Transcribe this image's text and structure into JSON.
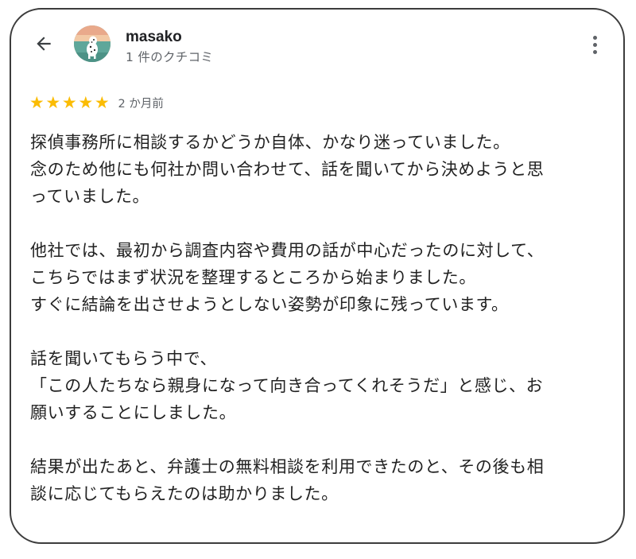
{
  "header": {
    "user_name": "masako",
    "review_count": "1 件のクチコミ"
  },
  "review": {
    "rating": 5,
    "max_rating": 5,
    "date": "2 か月前",
    "paragraphs": [
      [
        "探偵事務所に相談するかどうか自体、かなり迷っていました。",
        "念のため他にも何社か問い合わせて、話を聞いてから決めようと思",
        "っていました。"
      ],
      [
        "他社では、最初から調査内容や費用の話が中心だったのに対して、",
        "こちらではまず状況を整理するところから始まりました。",
        "すぐに結論を出させようとしない姿勢が印象に残っています。"
      ],
      [
        "話を聞いてもらう中で、",
        "「この人たちなら親身になって向き合ってくれそうだ」と感じ、お",
        "願いすることにしました。"
      ],
      [
        "結果が出たあと、弁護士の無料相談を利用できたのと、その後も相",
        "談に応じてもらえたのは助かりました。"
      ]
    ]
  },
  "icons": {
    "back": "arrow-back-icon",
    "more": "more-vert-icon",
    "star": "star-icon"
  },
  "colors": {
    "star": "#fbbc04",
    "text": "#202124",
    "secondary": "#5f6368",
    "border": "#3c3c3c"
  }
}
